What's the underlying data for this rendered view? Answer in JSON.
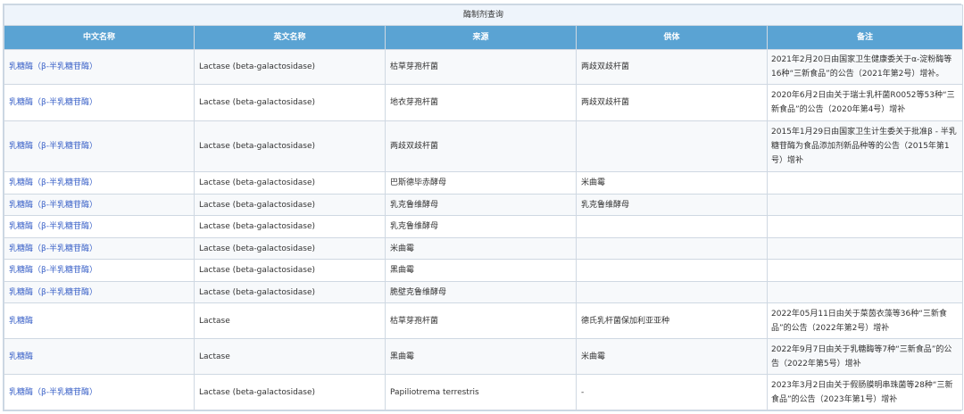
{
  "title": "酶制剂查询",
  "columns": [
    "中文名称",
    "英文名称",
    "来源",
    "供体",
    "备注"
  ],
  "rows": [
    {
      "cn": "乳糖酶（β-半乳糖苷酶）",
      "en": "Lactase (beta-galactosidase)",
      "source": "枯草芽孢杆菌",
      "donor": "两歧双歧杆菌",
      "note": "2021年2月20日由国家卫生健康委关于α-淀粉酶等16种“三新食品”的公告（2021年第2号）增补。"
    },
    {
      "cn": "乳糖酶（β-半乳糖苷酶）",
      "en": "Lactase (beta-galactosidase)",
      "source": "地衣芽孢杆菌",
      "donor": "两歧双歧杆菌",
      "note": "2020年6月2日由关于瑞士乳杆菌R0052等53种“三新食品”的公告（2020年第4号）增补"
    },
    {
      "cn": "乳糖酶（β-半乳糖苷酶）",
      "en": "Lactase (beta-galactosidase)",
      "source": "两歧双歧杆菌",
      "donor": "",
      "note": "2015年1月29日由国家卫生计生委关于批准β - 半乳糖苷酶为食品添加剂新品种等的公告（2015年第1号）增补"
    },
    {
      "cn": "乳糖酶（β-半乳糖苷酶）",
      "en": "Lactase (beta-galactosidase)",
      "source": "巴斯德毕赤酵母",
      "donor": "米曲霉",
      "note": ""
    },
    {
      "cn": "乳糖酶（β-半乳糖苷酶）",
      "en": "Lactase (beta-galactosidase)",
      "source": "乳克鲁维酵母",
      "donor": "乳克鲁维酵母",
      "note": ""
    },
    {
      "cn": "乳糖酶（β-半乳糖苷酶）",
      "en": "Lactase (beta-galactosidase)",
      "source": "乳克鲁维酵母",
      "donor": "",
      "note": ""
    },
    {
      "cn": "乳糖酶（β-半乳糖苷酶）",
      "en": "Lactase (beta-galactosidase)",
      "source": "米曲霉",
      "donor": "",
      "note": ""
    },
    {
      "cn": "乳糖酶（β-半乳糖苷酶）",
      "en": "Lactase (beta-galactosidase)",
      "source": "黑曲霉",
      "donor": "",
      "note": ""
    },
    {
      "cn": "乳糖酶（β-半乳糖苷酶）",
      "en": "Lactase (beta-galactosidase)",
      "source": "脆壁克鲁维酵母",
      "donor": "",
      "note": ""
    },
    {
      "cn": "乳糖酶",
      "en": "Lactase",
      "source": "枯草芽孢杆菌",
      "donor": "德氏乳杆菌保加利亚亚种",
      "note": "2022年05月11日由关于菜茵衣藻等36种“三新食品”的公告（2022年第2号）增补"
    },
    {
      "cn": "乳糖酶",
      "en": "Lactase",
      "source": "黑曲霉",
      "donor": "米曲霉",
      "note": "2022年9月7日由关于乳糖酶等7种“三新食品”的公告（2022年第5号）增补"
    },
    {
      "cn": "乳糖酶（β-半乳糖苷酶）",
      "en": "Lactase (beta-galactosidase)",
      "source": "Papiliotrema terrestris",
      "donor": "-",
      "note": "2023年3月2日由关于假肠膜明串珠菌等28种“三新食品”的公告（2023年第1号）增补"
    }
  ]
}
